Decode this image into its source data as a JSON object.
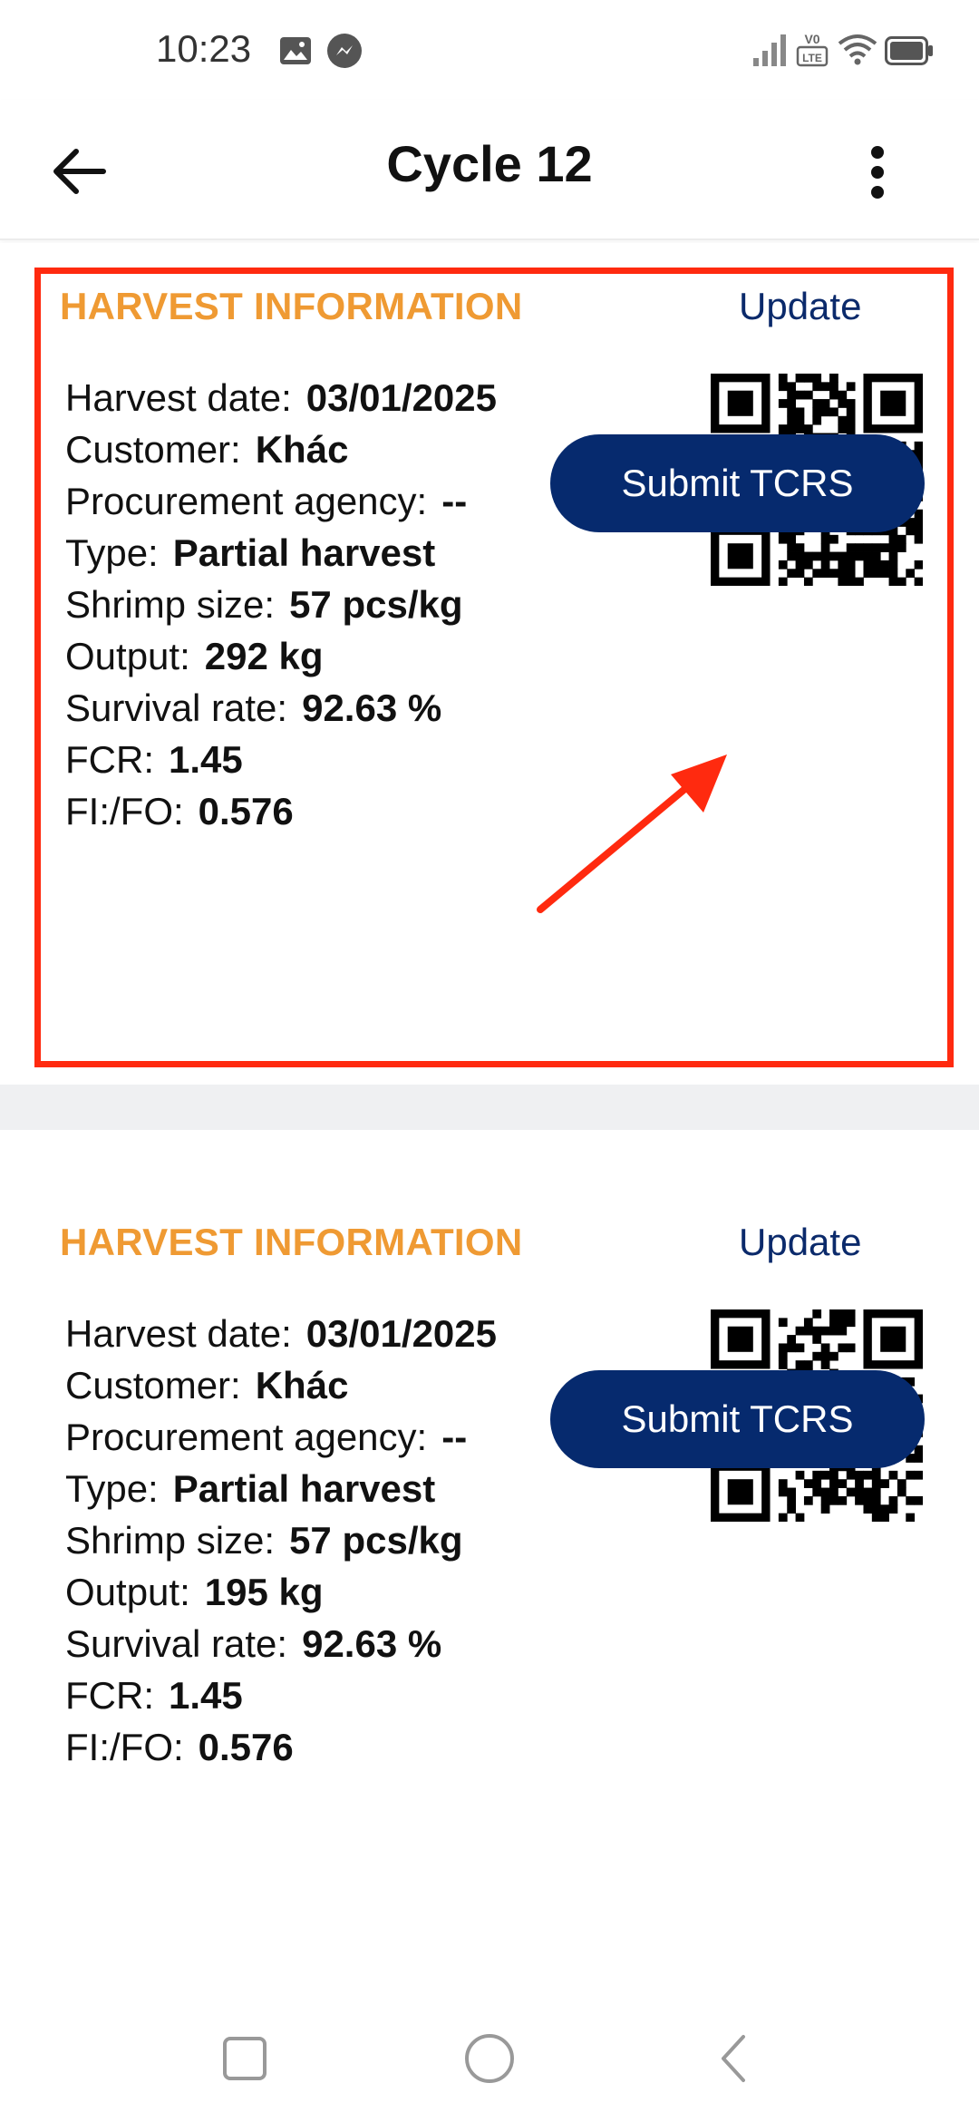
{
  "status_bar": {
    "time": "10:23",
    "icons": [
      "image-icon",
      "messenger-icon",
      "signal-icon",
      "volte-icon",
      "wifi-icon",
      "battery-icon"
    ]
  },
  "app_bar": {
    "title": "Cycle 12",
    "icons": [
      "arrow-left-icon",
      "more-vertical-icon"
    ]
  },
  "sections": [
    {
      "title": "HARVEST INFORMATION",
      "update_label": "Update",
      "submit_label": "Submit TCRS",
      "fields": [
        {
          "label": "Harvest date:",
          "value": "03/01/2025"
        },
        {
          "label": "Customer:",
          "value": "Khác"
        },
        {
          "label": "Procurement agency:",
          "value": "--"
        },
        {
          "label": "Type:",
          "value": "Partial harvest"
        },
        {
          "label": "Shrimp size:",
          "value": "57 pcs/kg"
        },
        {
          "label": "Output:",
          "value": "292 kg"
        },
        {
          "label": "Survival rate:",
          "value": "92.63 %"
        },
        {
          "label": "FCR:",
          "value": "1.45"
        },
        {
          "label": "FI:/FO:",
          "value": "0.576"
        }
      ]
    },
    {
      "title": "HARVEST INFORMATION",
      "update_label": "Update",
      "submit_label": "Submit TCRS",
      "fields": [
        {
          "label": "Harvest date:",
          "value": "03/01/2025"
        },
        {
          "label": "Customer:",
          "value": "Khác"
        },
        {
          "label": "Procurement agency:",
          "value": "--"
        },
        {
          "label": "Type:",
          "value": "Partial harvest"
        },
        {
          "label": "Shrimp size:",
          "value": "57 pcs/kg"
        },
        {
          "label": "Output:",
          "value": "195 kg"
        },
        {
          "label": "Survival rate:",
          "value": "92.63 %"
        },
        {
          "label": "FCR:",
          "value": "1.45"
        },
        {
          "label": "FI:/FO:",
          "value": "0.576"
        }
      ]
    }
  ],
  "nav_bar": {
    "icons": [
      "recent-apps-icon",
      "home-icon",
      "back-icon"
    ]
  },
  "colors": {
    "section_title": "#ef9a33",
    "primary": "#062a6e",
    "update_link": "#0b2a6b",
    "highlight": "#ff2a0f",
    "divider_band": "#eff0f2"
  }
}
